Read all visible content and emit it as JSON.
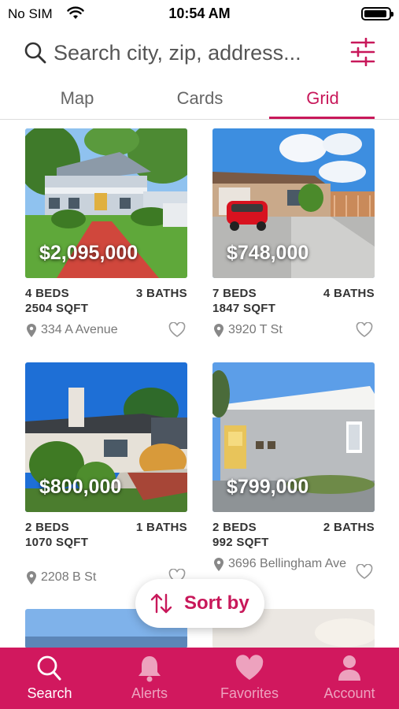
{
  "status": {
    "carrier": "No SIM",
    "time": "10:54 AM"
  },
  "search": {
    "placeholder": "Search city, zip, address..."
  },
  "tabs": [
    {
      "label": "Map"
    },
    {
      "label": "Cards"
    },
    {
      "label": "Grid",
      "active": true
    }
  ],
  "listings": [
    {
      "price": "$2,095,000",
      "beds": "4 BEDS",
      "baths": "3 BATHS",
      "sqft": "2504 SQFT",
      "address": "334 A Avenue"
    },
    {
      "price": "$748,000",
      "beds": "7 BEDS",
      "baths": "4 BATHS",
      "sqft": "1847 SQFT",
      "address": "3920 T St"
    },
    {
      "price": "$800,000",
      "beds": "2 BEDS",
      "baths": "1 BATHS",
      "sqft": "1070 SQFT",
      "address": "2208 B St"
    },
    {
      "price": "$799,000",
      "beds": "2 BEDS",
      "baths": "2 BATHS",
      "sqft": "992 SQFT",
      "address": "3696 Bellingham Ave"
    }
  ],
  "sort": {
    "label": "Sort by"
  },
  "nav": [
    {
      "label": "Search",
      "active": true
    },
    {
      "label": "Alerts"
    },
    {
      "label": "Favorites"
    },
    {
      "label": "Account"
    }
  ],
  "colors": {
    "accent": "#c8185a",
    "nav_bg": "#d1185e"
  }
}
